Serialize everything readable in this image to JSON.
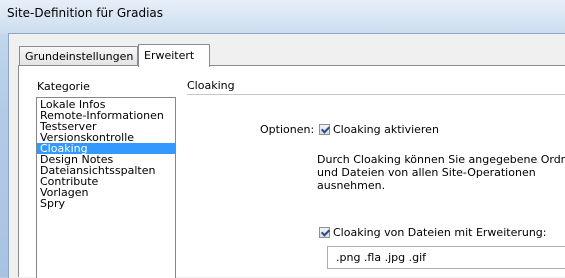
{
  "window": {
    "title": "Site-Definition für Gradias"
  },
  "tabs": [
    {
      "label": "Grundeinstellungen",
      "active": false
    },
    {
      "label": "Erweitert",
      "active": true
    }
  ],
  "sidebar": {
    "heading": "Kategorie",
    "items": [
      {
        "label": "Lokale Infos",
        "selected": false
      },
      {
        "label": "Remote-Informationen",
        "selected": false
      },
      {
        "label": "Testserver",
        "selected": false
      },
      {
        "label": "Versionskontrolle",
        "selected": false
      },
      {
        "label": "Cloaking",
        "selected": true
      },
      {
        "label": "Design Notes",
        "selected": false
      },
      {
        "label": "Dateiansichtsspalten",
        "selected": false
      },
      {
        "label": "Contribute",
        "selected": false
      },
      {
        "label": "Vorlagen",
        "selected": false
      },
      {
        "label": "Spry",
        "selected": false
      }
    ]
  },
  "cloaking": {
    "section_title": "Cloaking",
    "options_label": "Optionen:",
    "enable_label": "Cloaking aktivieren",
    "enable_checked": true,
    "description_lines": [
      "Durch Cloaking können Sie angegebene Ordne",
      "und Dateien von allen Site-Operationen",
      "ausnehmen."
    ],
    "extension_label": "Cloaking von Dateien mit Erweiterung:",
    "extension_checked": true,
    "extensions_value": ".png .fla .jpg .gif"
  },
  "colors": {
    "selection": "#3399ff",
    "frame": "#b9cde5"
  }
}
